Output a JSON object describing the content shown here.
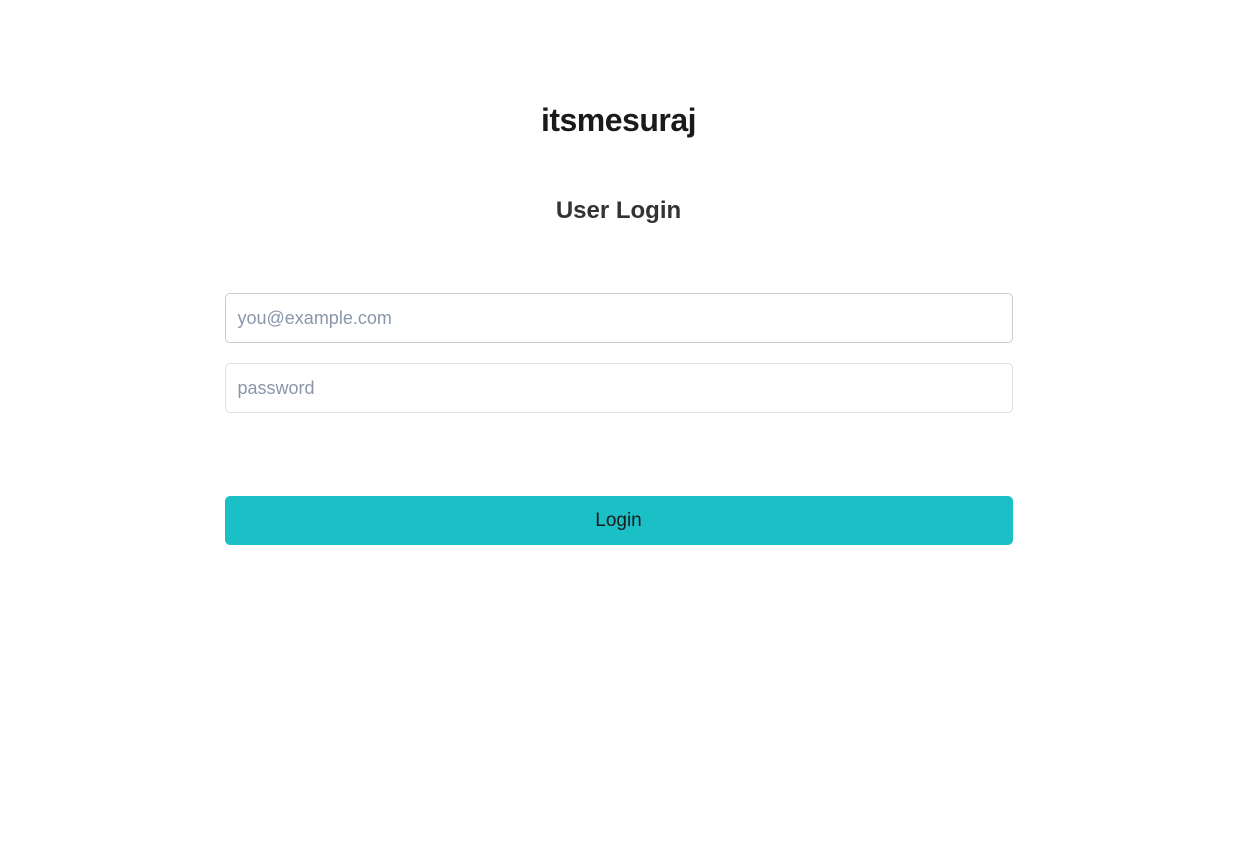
{
  "brand": {
    "title": "itsmesuraj"
  },
  "form": {
    "title": "User Login",
    "email": {
      "placeholder": "you@example.com",
      "value": ""
    },
    "password": {
      "placeholder": "password",
      "value": ""
    },
    "login_button_label": "Login"
  }
}
